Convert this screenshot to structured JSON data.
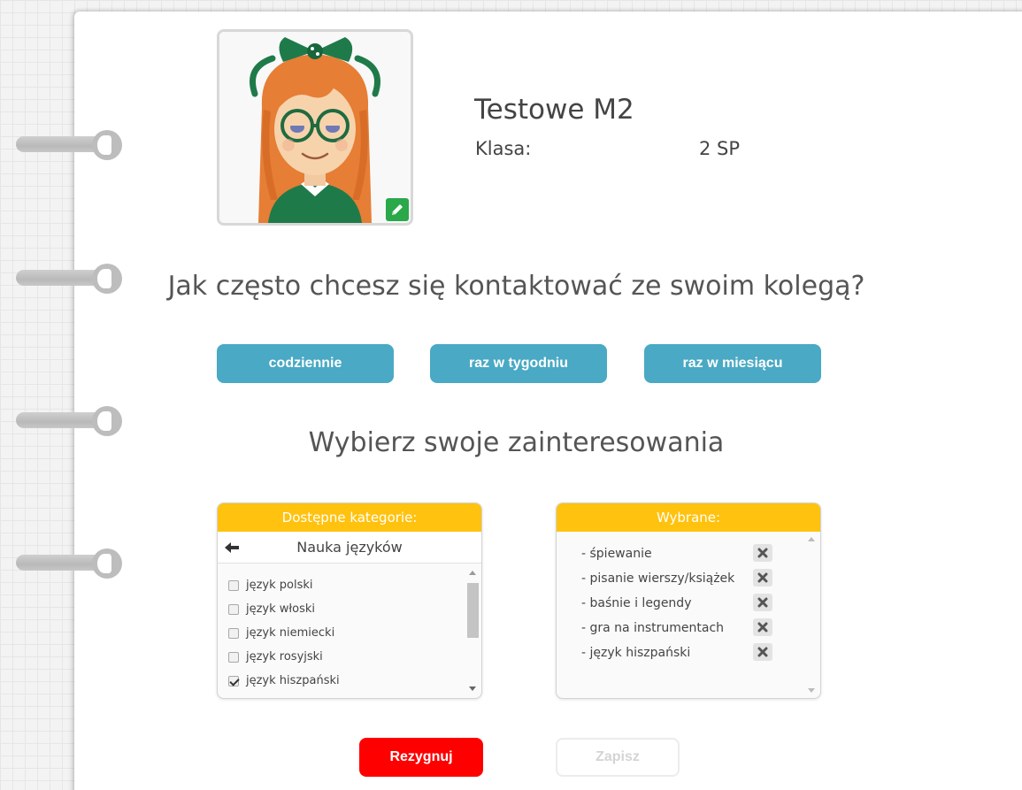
{
  "profile": {
    "name": "Testowe M2",
    "class_label": "Klasa:",
    "class_value": "2 SP"
  },
  "contact": {
    "question": "Jak często chcesz się kontaktować ze swoim kolegą?",
    "options": [
      "codziennie",
      "raz w tygodniu",
      "raz w miesiącu"
    ]
  },
  "interests": {
    "title": "Wybierz swoje zainteresowania",
    "available": {
      "header": "Dostępne kategorie:",
      "category": "Nauka języków",
      "items": [
        {
          "label": "język polski",
          "checked": false
        },
        {
          "label": "język włoski",
          "checked": false
        },
        {
          "label": "język niemiecki",
          "checked": false
        },
        {
          "label": "język rosyjski",
          "checked": false
        },
        {
          "label": "język hiszpański",
          "checked": true
        }
      ]
    },
    "selected": {
      "header": "Wybrane:",
      "items": [
        "- śpiewanie",
        "- pisanie wierszy/książek",
        "- baśnie i legendy",
        "- gra na instrumentach",
        "- język hiszpański"
      ]
    }
  },
  "actions": {
    "cancel": "Rezygnuj",
    "save": "Zapisz"
  },
  "colors": {
    "accent_blue": "#4aa9c4",
    "panel_yellow": "#ffc20e",
    "cancel_red": "#ff0000",
    "edit_green": "#2aa84a"
  },
  "icons": {
    "edit": "pencil-icon",
    "back": "arrow-left-icon",
    "remove": "close-icon"
  }
}
